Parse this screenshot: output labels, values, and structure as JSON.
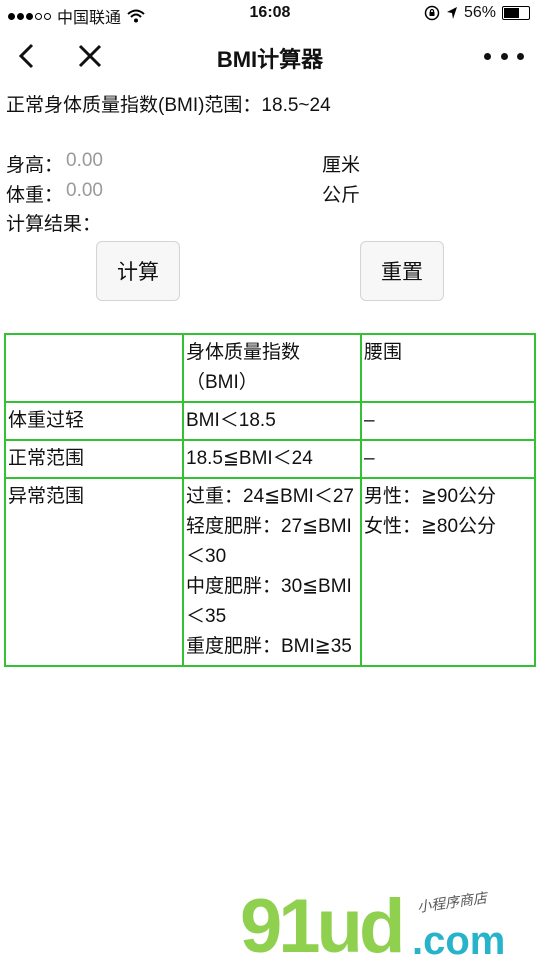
{
  "status_bar": {
    "carrier": "中国联通",
    "time": "16:08",
    "battery": "56%",
    "battery_level": 0.56,
    "icons": [
      "signal-dots",
      "wifi-icon",
      "lock-rotation-icon",
      "location-arrow-icon",
      "battery-icon"
    ]
  },
  "nav": {
    "title": "BMI计算器",
    "icons": [
      "back-chevron-icon",
      "close-icon",
      "more-dots-icon"
    ]
  },
  "range_text": "正常身体质量指数(BMI)范围：18.5~24",
  "form": {
    "height_label": "身高：",
    "height_placeholder": "0.00",
    "height_unit": "厘米",
    "weight_label": "体重：",
    "weight_placeholder": "0.00",
    "weight_unit": "公斤",
    "result_label": "计算结果："
  },
  "buttons": {
    "calculate": "计算",
    "reset": "重置"
  },
  "table": {
    "header": [
      "",
      "身体质量指数（BMI）",
      "腰围"
    ],
    "rows": [
      {
        "category": "体重过轻",
        "bmi": [
          "BMI＜18.5"
        ],
        "waist": [
          "–"
        ]
      },
      {
        "category": "正常范围",
        "bmi": [
          "18.5≦BMI＜24"
        ],
        "waist": [
          "–"
        ]
      },
      {
        "category": "异常范围",
        "bmi": [
          "过重：24≦BMI＜27",
          "轻度肥胖：27≦BMI＜30",
          "中度肥胖：30≦BMI＜35",
          "重度肥胖：BMI≧35"
        ],
        "waist": [
          "男性：≧90公分",
          "女性：≧80公分"
        ]
      }
    ]
  },
  "watermark": {
    "logo": "91ud",
    "domain": ".com",
    "tagline": "小程序商店"
  },
  "colors": {
    "table_border": "#34c234",
    "placeholder": "#9a9a9a",
    "watermark_green": "#8fd14f",
    "watermark_teal": "#27b3c9"
  }
}
